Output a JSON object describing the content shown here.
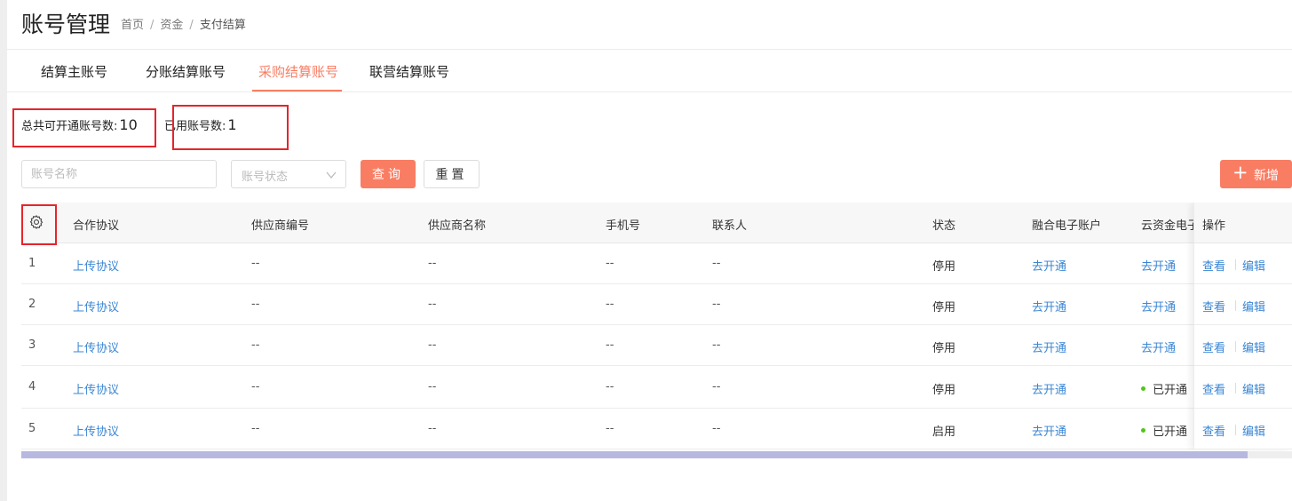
{
  "header": {
    "title": "账号管理",
    "breadcrumb": [
      "首页",
      "资金",
      "支付结算"
    ],
    "separator": "/"
  },
  "tabs": [
    {
      "label": "结算主账号",
      "active": false
    },
    {
      "label": "分账结算账号",
      "active": false
    },
    {
      "label": "采购结算账号",
      "active": true
    },
    {
      "label": "联营结算账号",
      "active": false
    }
  ],
  "stats": {
    "total_label": "总共可开通账号数:",
    "total_value": "10",
    "used_label": "已用账号数:",
    "used_value": "1"
  },
  "filters": {
    "name_placeholder": "账号名称",
    "status_placeholder": "账号状态",
    "query_label": "查询",
    "reset_label": "重置",
    "add_label": "新增"
  },
  "table": {
    "columns": [
      "合作协议",
      "供应商编号",
      "供应商名称",
      "手机号",
      "联系人",
      "状态",
      "融合电子账户",
      "云资金电子",
      "操作"
    ],
    "rows": [
      {
        "index": "1",
        "agreement": "上传协议",
        "supplier_no": "--",
        "supplier_name": "--",
        "phone": "--",
        "contact": "--",
        "status": "停用",
        "fusion_account": "去开通",
        "cloud_account": "去开通",
        "cloud_opened": false,
        "view": "查看",
        "edit": "编辑"
      },
      {
        "index": "2",
        "agreement": "上传协议",
        "supplier_no": "--",
        "supplier_name": "--",
        "phone": "--",
        "contact": "--",
        "status": "停用",
        "fusion_account": "去开通",
        "cloud_account": "去开通",
        "cloud_opened": false,
        "view": "查看",
        "edit": "编辑"
      },
      {
        "index": "3",
        "agreement": "上传协议",
        "supplier_no": "--",
        "supplier_name": "--",
        "phone": "--",
        "contact": "--",
        "status": "停用",
        "fusion_account": "去开通",
        "cloud_account": "去开通",
        "cloud_opened": false,
        "view": "查看",
        "edit": "编辑"
      },
      {
        "index": "4",
        "agreement": "上传协议",
        "supplier_no": "--",
        "supplier_name": "--",
        "phone": "--",
        "contact": "--",
        "status": "停用",
        "fusion_account": "去开通",
        "cloud_account": "已开通",
        "cloud_opened": true,
        "view": "查看",
        "edit": "编辑"
      },
      {
        "index": "5",
        "agreement": "上传协议",
        "supplier_no": "--",
        "supplier_name": "--",
        "phone": "--",
        "contact": "--",
        "status": "启用",
        "fusion_account": "去开通",
        "cloud_account": "已开通",
        "cloud_opened": true,
        "view": "查看",
        "edit": "编辑"
      }
    ]
  },
  "scrollbar": {
    "position_fraction": 0.965
  },
  "colors": {
    "accent": "#f97d63",
    "link": "#3a86d4",
    "highlight_box": "#e5252b",
    "success_dot": "#52c41a",
    "scroll_thumb": "#b7b8e0"
  },
  "icons": {
    "settings": "gear-icon",
    "dropdown": "chevron-down-icon",
    "add": "plus-icon",
    "status_dot": "status-dot"
  }
}
